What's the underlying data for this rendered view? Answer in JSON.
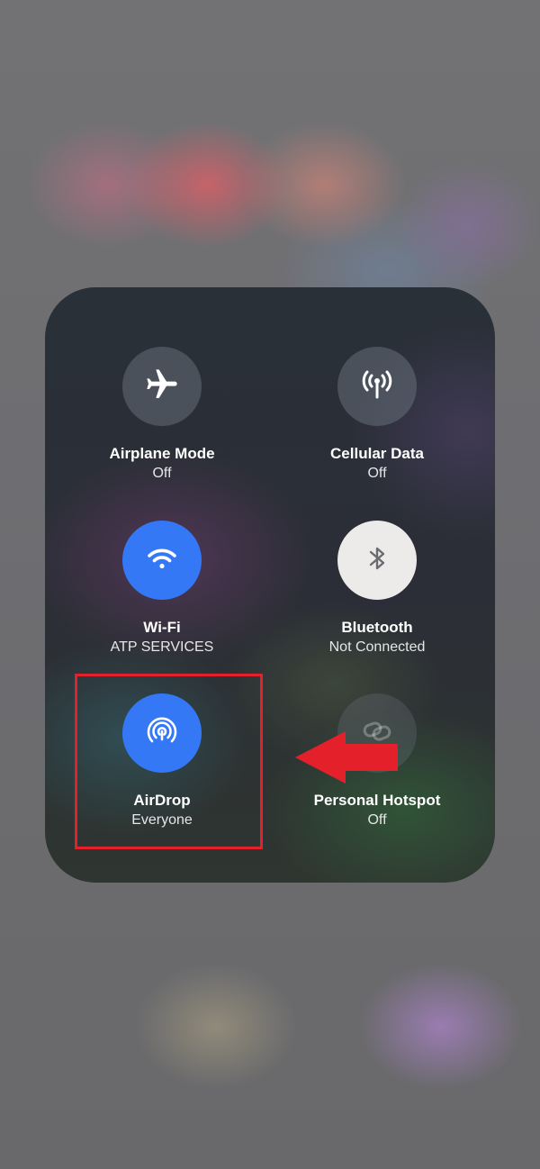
{
  "control_center": {
    "tiles": [
      {
        "id": "airplane",
        "label": "Airplane Mode",
        "status": "Off",
        "state": "off",
        "icon": "airplane-icon"
      },
      {
        "id": "cellular",
        "label": "Cellular Data",
        "status": "Off",
        "state": "off",
        "icon": "cellular-antenna-icon"
      },
      {
        "id": "wifi",
        "label": "Wi-Fi",
        "status": "ATP SERVICES",
        "state": "on",
        "icon": "wifi-icon"
      },
      {
        "id": "bluetooth",
        "label": "Bluetooth",
        "status": "Not Connected",
        "state": "on",
        "icon": "bluetooth-icon"
      },
      {
        "id": "airdrop",
        "label": "AirDrop",
        "status": "Everyone",
        "state": "on",
        "icon": "airdrop-icon"
      },
      {
        "id": "hotspot",
        "label": "Personal Hotspot",
        "status": "Off",
        "state": "disabled",
        "icon": "hotspot-link-icon"
      }
    ]
  },
  "annotation": {
    "highlight": "airdrop",
    "highlight_color": "#e4202a",
    "arrow_color": "#e4202a"
  },
  "colors": {
    "accent_blue": "#3478f6",
    "bluetooth_on": "#ecebea"
  }
}
